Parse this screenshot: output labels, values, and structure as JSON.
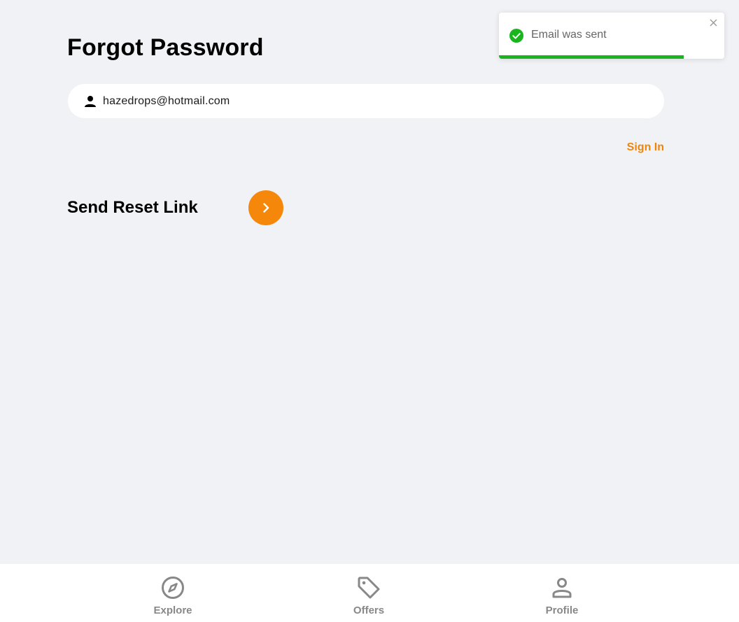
{
  "page": {
    "title": "Forgot Password"
  },
  "form": {
    "email_value": "hazedrops@hotmail.com",
    "email_placeholder": "",
    "sign_in_label": "Sign In",
    "send_label": "Send Reset Link"
  },
  "toast": {
    "message": "Email was sent",
    "status": "success",
    "progress": 0.82
  },
  "nav": {
    "items": [
      {
        "label": "Explore",
        "icon": "compass-icon"
      },
      {
        "label": "Offers",
        "icon": "tag-icon"
      },
      {
        "label": "Profile",
        "icon": "person-icon"
      }
    ]
  },
  "colors": {
    "accent": "#f5870a",
    "success": "#1ab41e",
    "background": "#f1f2f6",
    "nav_inactive": "#888888"
  }
}
